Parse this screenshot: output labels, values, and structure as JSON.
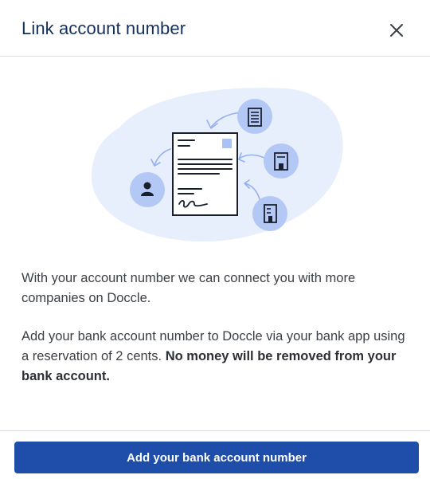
{
  "dialog": {
    "title": "Link account number",
    "close_icon": "close-icon"
  },
  "illustration": {
    "icons": [
      "document-icon",
      "person-icon",
      "building-icon",
      "building-icon",
      "building-icon",
      "arrow-icon"
    ],
    "colors": {
      "blob": "#e8effc",
      "circle": "#b4c8f6",
      "ink": "#1a1f2e",
      "accent": "#a9c1f4"
    }
  },
  "content": {
    "paragraph_1": "With your account number we can connect you with more companies on Doccle.",
    "paragraph_2_start": "Add your bank account number to Doccle via your bank app using a reservation of 2 cents. ",
    "paragraph_2_bold": "No money will be removed from your bank account."
  },
  "footer": {
    "primary_button_label": "Add your bank account number"
  },
  "colors": {
    "title": "#142f5c",
    "button": "#1e4ea9",
    "divider": "#dcdfe4",
    "text": "#3b3f46"
  }
}
